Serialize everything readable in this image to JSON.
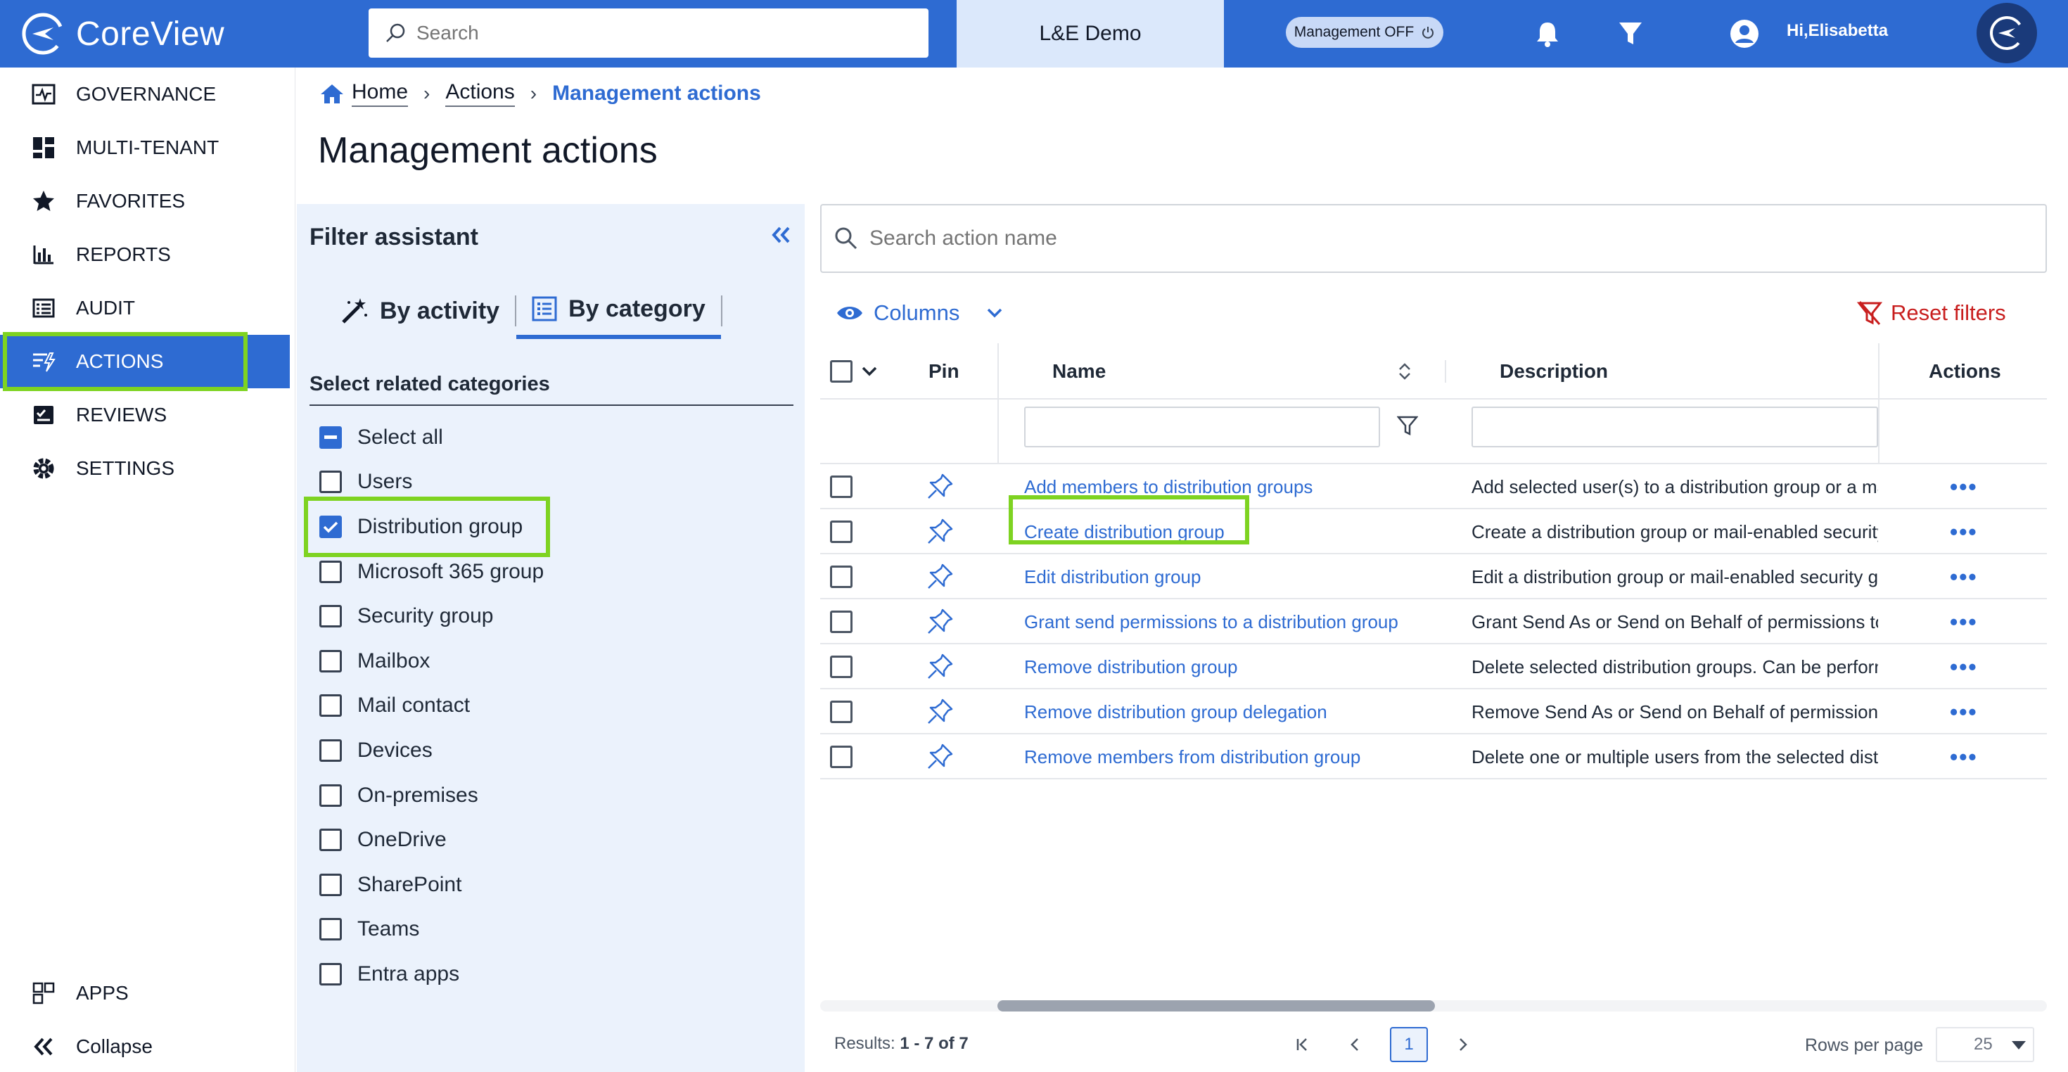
{
  "header": {
    "logo_text": "CoreView",
    "search_placeholder": "Search",
    "tenant": "L&E Demo",
    "management_toggle": "Management OFF",
    "greeting": "Hi,Elisabetta"
  },
  "sidebar": {
    "items": [
      {
        "label": "GOVERNANCE",
        "icon": "governance-icon"
      },
      {
        "label": "MULTI-TENANT",
        "icon": "multi-tenant-icon"
      },
      {
        "label": "FAVORITES",
        "icon": "star-icon"
      },
      {
        "label": "REPORTS",
        "icon": "bar-chart-icon"
      },
      {
        "label": "AUDIT",
        "icon": "audit-list-icon"
      },
      {
        "label": "ACTIONS",
        "icon": "actions-icon",
        "active": true
      },
      {
        "label": "REVIEWS",
        "icon": "review-check-icon"
      },
      {
        "label": "SETTINGS",
        "icon": "gear-icon"
      }
    ],
    "apps_label": "APPS",
    "collapse_label": "Collapse"
  },
  "breadcrumb": {
    "home": "Home",
    "actions": "Actions",
    "current": "Management actions"
  },
  "page_title": "Management actions",
  "filter_assistant": {
    "title": "Filter assistant",
    "tabs": [
      {
        "label": "By activity",
        "active": false
      },
      {
        "label": "By category",
        "active": true
      }
    ],
    "subtitle": "Select related categories",
    "categories": [
      {
        "label": "Select all",
        "state": "indeterminate"
      },
      {
        "label": "Users",
        "state": "unchecked"
      },
      {
        "label": "Distribution group",
        "state": "checked"
      },
      {
        "label": "Microsoft 365 group",
        "state": "unchecked"
      },
      {
        "label": "Security group",
        "state": "unchecked"
      },
      {
        "label": "Mailbox",
        "state": "unchecked"
      },
      {
        "label": "Mail contact",
        "state": "unchecked"
      },
      {
        "label": "Devices",
        "state": "unchecked"
      },
      {
        "label": "On-premises",
        "state": "unchecked"
      },
      {
        "label": "OneDrive",
        "state": "unchecked"
      },
      {
        "label": "SharePoint",
        "state": "unchecked"
      },
      {
        "label": "Teams",
        "state": "unchecked"
      },
      {
        "label": "Entra apps",
        "state": "unchecked"
      }
    ]
  },
  "actions_search_placeholder": "Search action name",
  "toolbar": {
    "columns": "Columns",
    "reset": "Reset filters"
  },
  "table": {
    "headers": {
      "pin": "Pin",
      "name": "Name",
      "description": "Description",
      "actions": "Actions"
    },
    "rows": [
      {
        "name": "Add members to distribution groups",
        "description": "Add selected user(s) to a distribution group or a mai"
      },
      {
        "name": "Create distribution group",
        "description": "Create a distribution group or mail-enabled security"
      },
      {
        "name": "Edit distribution group",
        "description": "Edit a distribution group or mail-enabled security gr"
      },
      {
        "name": "Grant send permissions to a distribution group",
        "description": "Grant Send As or Send on Behalf of permissions to a"
      },
      {
        "name": "Remove distribution group",
        "description": "Delete selected distribution groups. Can be perform"
      },
      {
        "name": "Remove distribution group delegation",
        "description": "Remove Send As or Send on Behalf of permissions f"
      },
      {
        "name": "Remove members from distribution group",
        "description": "Delete one or multiple users from the selected distr"
      }
    ]
  },
  "footer": {
    "results_label": "Results:",
    "results_value": "1 - 7 of 7",
    "current_page": "1",
    "rows_per_page_label": "Rows per page",
    "rows_per_page": "25"
  },
  "colors": {
    "primary": "#2e6bd2",
    "highlight": "#7ed321",
    "danger": "#c81e1e",
    "panel": "#ebf2fc"
  }
}
